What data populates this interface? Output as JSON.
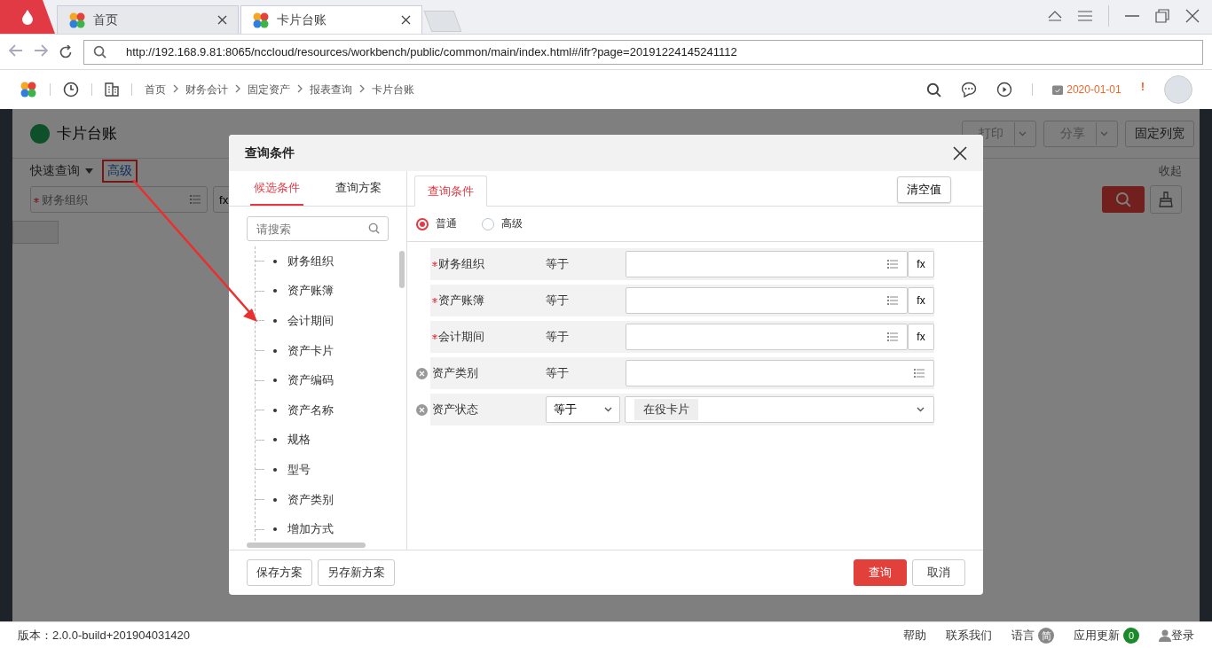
{
  "browser": {
    "tabs": [
      {
        "label": "首页",
        "selected": false
      },
      {
        "label": "卡片台账",
        "selected": true
      }
    ],
    "url": "http://192.168.9.81:8065/nccloud/resources/workbench/public/common/main/index.html#/ifr?page=20191224145241112"
  },
  "header": {
    "breadcrumb": [
      "首页",
      "财务会计",
      "固定资产",
      "报表查询",
      "卡片台账"
    ],
    "date": "2020-01-01",
    "alert": "!"
  },
  "page": {
    "title": "卡片台账",
    "toolbar": [
      {
        "label": "打印",
        "kind": "split"
      },
      {
        "label": "分享",
        "kind": "split"
      },
      {
        "label": "固定列宽",
        "kind": "plain"
      }
    ],
    "quick_query": "快速查询",
    "advanced": "高级",
    "collapse": "收起",
    "field": {
      "placeholder": "财务组织",
      "required": true
    },
    "fx": "fx"
  },
  "dialog": {
    "title": "查询条件",
    "left_tabs": [
      {
        "label": "候选条件",
        "selected": true
      },
      {
        "label": "查询方案",
        "selected": false
      }
    ],
    "search": {
      "placeholder": "请搜索"
    },
    "tree_items": [
      "财务组织",
      "资产账簿",
      "会计期间",
      "资产卡片",
      "资产编码",
      "资产名称",
      "规格",
      "型号",
      "资产类别",
      "增加方式"
    ],
    "right_tab": "查询条件",
    "clear": "清空值",
    "modes": [
      {
        "label": "普通",
        "selected": true
      },
      {
        "label": "高级",
        "selected": false
      }
    ],
    "conditions": [
      {
        "name": "财务组织",
        "required": true,
        "removable": false,
        "operator": "等于",
        "kind": "ref",
        "fx": "fx"
      },
      {
        "name": "资产账簿",
        "required": true,
        "removable": false,
        "operator": "等于",
        "kind": "ref",
        "fx": "fx"
      },
      {
        "name": "会计期间",
        "required": true,
        "removable": false,
        "operator": "等于",
        "kind": "ref",
        "fx": "fx"
      },
      {
        "name": "资产类别",
        "required": false,
        "removable": true,
        "operator": "等于",
        "kind": "ref"
      },
      {
        "name": "资产状态",
        "required": false,
        "removable": true,
        "operator": "等于",
        "kind": "select",
        "value": "在役卡片"
      }
    ],
    "footer_left": [
      "保存方案",
      "另存新方案"
    ],
    "query": "查询",
    "cancel": "取消"
  },
  "status_bar": {
    "version": "版本：2.0.0-build+201904031420",
    "links": [
      "帮助",
      "联系我们"
    ],
    "language": "语言",
    "language_badge": "简",
    "updates": "应用更新",
    "updates_count": "0",
    "login": "登录"
  }
}
